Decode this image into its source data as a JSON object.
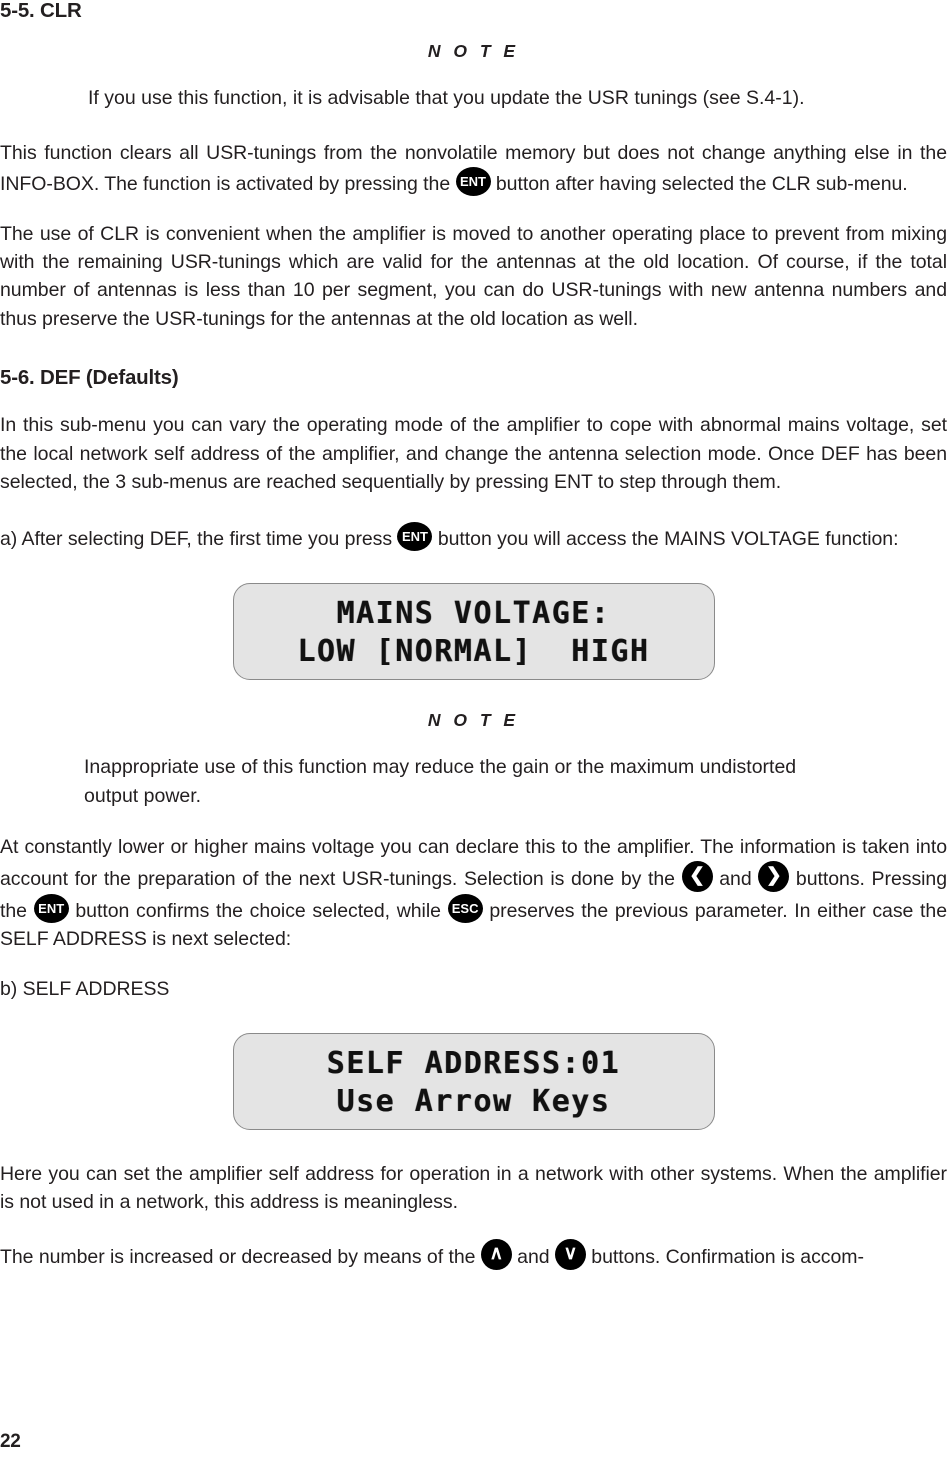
{
  "document": {
    "page_number": "22"
  },
  "sections": {
    "clr": {
      "heading": "5-5. CLR",
      "note_label": "N O T E",
      "note_body": "If you use this function, it is advisable that you update the USR tunings (see S.4-1).",
      "para1_a": "This function clears all USR-tunings from the nonvolatile memory but does not change anything else in the INFO-BOX. The function is activated by pressing the ",
      "para1_key": "ENT",
      "para1_b": " button after having selected the CLR sub-menu.",
      "para2": "The use of CLR is convenient when the amplifier is moved to another operating place to prevent from mixing with the remaining USR-tunings which are valid for the antennas at the old location. Of course, if the total number of antennas is less than 10 per segment, you can do USR-tunings with new antenna numbers and thus preserve the USR-tunings for the antennas at the old location as well."
    },
    "def": {
      "heading": "5-6. DEF (Defaults)",
      "para1": "In this sub-menu you can vary the operating mode of the amplifier to cope with abnormal mains voltage, set the local network self address of the amplifier, and change the antenna selection mode.  Once DEF has been selected, the 3 sub-menus are reached sequentially by pressing ENT to step through them.",
      "item_a_text1": "a) After selecting DEF, the first time you press ",
      "item_a_key": "ENT",
      "item_a_text2": " button you will access the MAINS VOLTAGE function:",
      "lcd_mains": {
        "line1": "MAINS VOLTAGE:",
        "line2": "LOW [NORMAL]  HIGH"
      },
      "note_label": "N O T E",
      "note_body": "Inappropriate use of this function may reduce the gain or the maximum undistorted output power.",
      "para_mains_a": "At constantly lower or higher mains voltage you can declare this to the amplifier. The information is taken into account for the preparation of the next USR-tunings. Selection is done by the ",
      "key_left": "❮",
      "para_mains_b": " and ",
      "key_right": "❯",
      "para_mains_c": " buttons. Pressing the ",
      "key_ent": "ENT",
      "para_mains_d": " button confirms the choice selected, while ",
      "key_esc": "ESC",
      "para_mains_e": " preserves the previous parameter. In either case the SELF ADDRESS is next selected:",
      "item_b_text": "b) SELF ADDRESS",
      "lcd_self_address": {
        "line1": "SELF ADDRESS:01",
        "line2": "Use Arrow Keys"
      },
      "para_self_1": "Here you can set the amplifier self address for operation in a network with other systems. When the amplifier is not used in a network, this address is meaningless.",
      "para_self_2_a": "The number is increased or decreased by means of the ",
      "key_up": "∧",
      "para_self_2_b": " and ",
      "key_down": "∨",
      "para_self_2_c": " buttons. Confirmation is accom-"
    }
  },
  "colors": {
    "text": "#231f20",
    "lcd_background": "#e4e4e4",
    "lcd_border": "#8a8a8a",
    "keycap_background": "#000000",
    "keycap_foreground": "#ffffff"
  }
}
